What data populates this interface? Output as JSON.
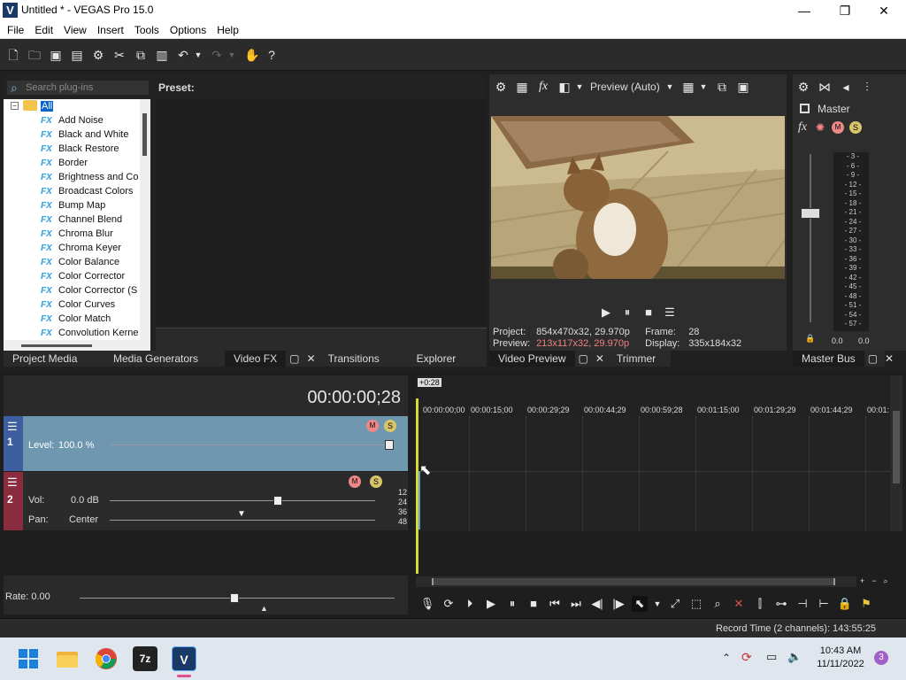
{
  "window": {
    "title": "Untitled * - VEGAS Pro 15.0",
    "logo": "V",
    "minimize": "—",
    "maximize": "❐",
    "close": "✕"
  },
  "menu": [
    "File",
    "Edit",
    "View",
    "Insert",
    "Tools",
    "Options",
    "Help"
  ],
  "fx": {
    "search_placeholder": "Search plug-ins",
    "preset_label": "Preset:",
    "tree_root": "All",
    "fx_tag": "FX",
    "plugins": [
      "Add Noise",
      "Black and White",
      "Black Restore",
      "Border",
      "Brightness and Co",
      "Broadcast Colors",
      "Bump Map",
      "Channel Blend",
      "Chroma Blur",
      "Chroma Keyer",
      "Color Balance",
      "Color Corrector",
      "Color Corrector (S",
      "Color Curves",
      "Color Match",
      "Convolution Kerne"
    ]
  },
  "left_tabs": [
    "Project Media",
    "Media Generators",
    "Video FX",
    "Transitions",
    "Explorer"
  ],
  "preview": {
    "mode": "Preview (Auto)",
    "project_label": "Project:",
    "project_value": "854x470x32, 29.970p",
    "frame_label": "Frame:",
    "frame_value": "28",
    "preview_label": "Preview:",
    "preview_value": "213x117x32, 29.970p",
    "display_label": "Display:",
    "display_value": "335x184x32"
  },
  "preview_tabs": [
    "Video Preview",
    "Trimmer"
  ],
  "master": {
    "label": "Master",
    "scale": [
      "3",
      "6",
      "9",
      "12",
      "15",
      "18",
      "21",
      "24",
      "27",
      "30",
      "33",
      "36",
      "39",
      "42",
      "45",
      "48",
      "51",
      "54",
      "57"
    ],
    "left_value": "0.0",
    "right_value": "0.0"
  },
  "master_tabs": [
    "Master Bus"
  ],
  "timeline": {
    "timecode": "00:00:00;28",
    "marker": "+0:28",
    "ruler": [
      "00:00:00;00",
      "00:00:15;00",
      "00:00:29;29",
      "00:00:44;29",
      "00:00:59;28",
      "00:01:15;00",
      "00:01:29;29",
      "00:01:44;29",
      "00:01:"
    ],
    "track1": {
      "number": "1",
      "level_label": "Level:",
      "level_value": "100.0 %"
    },
    "track2": {
      "number": "2",
      "vol_label": "Vol:",
      "vol_value": "0.0 dB",
      "pan_label": "Pan:",
      "pan_value": "Center",
      "meter": [
        "12",
        "24",
        "36",
        "48"
      ]
    },
    "rate_label": "Rate: 0.00"
  },
  "status": {
    "record_time": "Record Time (2 channels): 143:55:25"
  },
  "taskbar": {
    "time": "10:43 AM",
    "date": "11/11/2022",
    "notifications": "3",
    "sevenzip": "7z",
    "vegas": "V"
  },
  "colors": {
    "accent": "#29a0e0",
    "track_video": "#3d5fa0",
    "track_audio": "#8a2c3e",
    "playhead": "#d8d830"
  }
}
